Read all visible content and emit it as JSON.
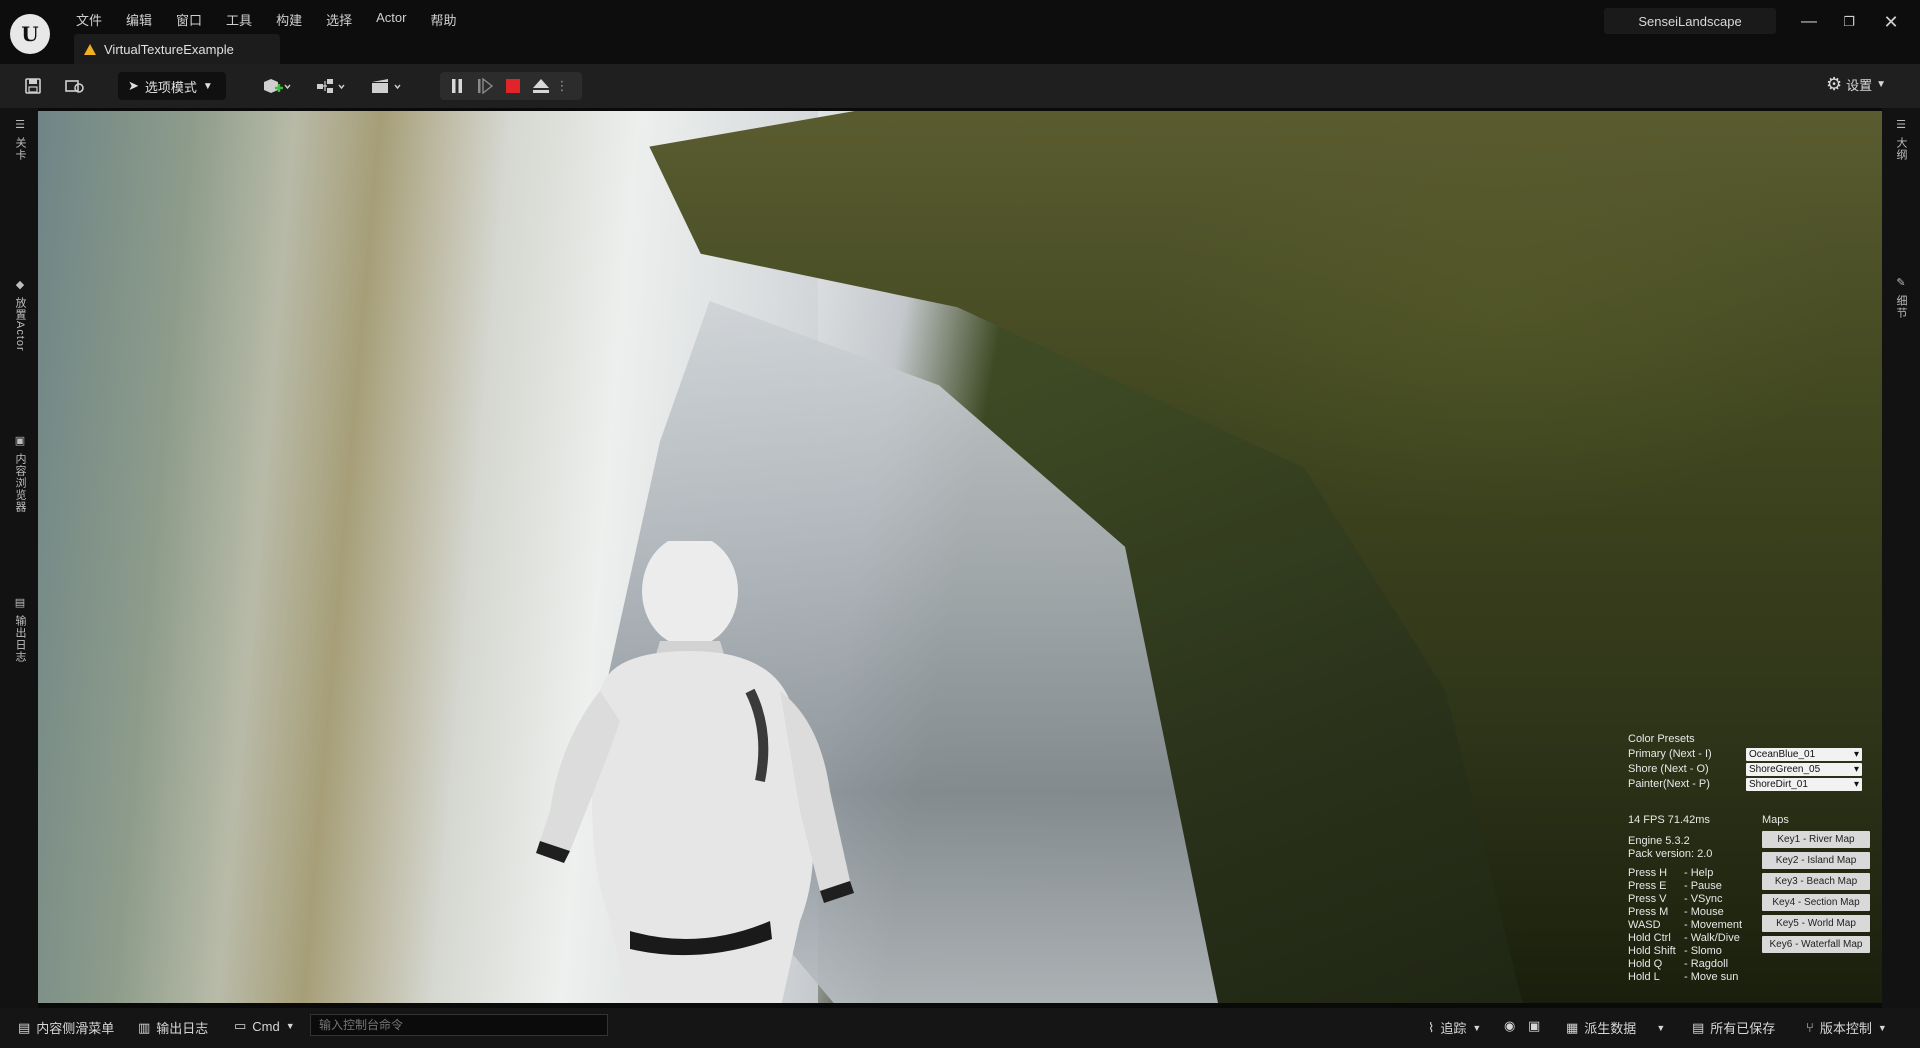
{
  "menu": [
    "文件",
    "编辑",
    "窗口",
    "工具",
    "构建",
    "选择",
    "Actor",
    "帮助"
  ],
  "doc_tab": "VirtualTextureExample",
  "project_name": "SenseiLandscape",
  "toolbar": {
    "mode_label": "选项模式",
    "settings_label": "设置"
  },
  "left_tabs": [
    "关卡",
    "放置Actor",
    "内容浏览器",
    "输出日志"
  ],
  "right_tabs": [
    "大纲",
    "细节"
  ],
  "hud": {
    "color_presets_title": "Color Presets",
    "presets": [
      {
        "label": "Primary (Next - I)",
        "value": "OceanBlue_01"
      },
      {
        "label": "Shore (Next - O)",
        "value": "ShoreGreen_05"
      },
      {
        "label": "Painter(Next - P)",
        "value": "ShoreDirt_01"
      }
    ],
    "fps": "14 FPS 71.42ms",
    "maps_title": "Maps",
    "engine": "Engine 5.3.2",
    "pack_version": "Pack version: 2.0",
    "help": [
      {
        "key": "Press H",
        "desc": "- Help"
      },
      {
        "key": "Press E",
        "desc": "- Pause"
      },
      {
        "key": "Press V",
        "desc": "- VSync"
      },
      {
        "key": "Press M",
        "desc": "- Mouse"
      },
      {
        "key": "WASD",
        "desc": "- Movement"
      },
      {
        "key": "Hold Ctrl",
        "desc": "- Walk/Dive"
      },
      {
        "key": "Hold Shift",
        "desc": "- Slomo"
      },
      {
        "key": "Hold Q",
        "desc": "- Ragdoll"
      },
      {
        "key": "Hold L",
        "desc": "- Move sun"
      }
    ],
    "maps": [
      "Key1 - River Map",
      "Key2 - Island Map",
      "Key3 - Beach Map",
      "Key4 - Section Map",
      "Key5 - World Map",
      "Key6 - Waterfall Map"
    ]
  },
  "statusbar": {
    "content_drawer": "内容侧滑菜单",
    "output_log": "输出日志",
    "cmd": "Cmd",
    "console_placeholder": "输入控制台命令",
    "trace": "追踪",
    "derived_data": "派生数据",
    "all_saved": "所有已保存",
    "source_control": "版本控制"
  },
  "colors": {
    "accent_warning": "#f0b020",
    "stop_red": "#e0242a"
  }
}
